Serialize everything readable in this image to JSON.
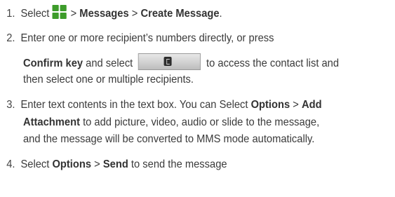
{
  "steps": [
    {
      "number": "1.",
      "pre": "Select ",
      "menu_icon": "menu-grid-icon",
      "sep1": " > ",
      "item1": "Messages",
      "sep2": " > ",
      "item2": "Create Message",
      "end": "."
    },
    {
      "number": "2.",
      "line1": "Enter one or more recipient’s numbers directly, or press",
      "confirm": "Confirm key",
      "mid": " and select ",
      "contact_icon": "contact-list-icon",
      "after": " to access the contact list and",
      "line3": "then select one or multiple recipients."
    },
    {
      "number": "3.",
      "pre": "Enter text contents in the text box. You can Select ",
      "options": "Options",
      "sep": " > ",
      "add": "Add",
      "attachment": "Attachment",
      "line2_rest": " to add picture, video, audio or slide to the message,",
      "line3": "and the message will be converted to MMS mode automatically."
    },
    {
      "number": "4.",
      "pre": "Select ",
      "options": "Options",
      "sep": " > ",
      "send": "Send",
      "end": " to send the message"
    }
  ]
}
